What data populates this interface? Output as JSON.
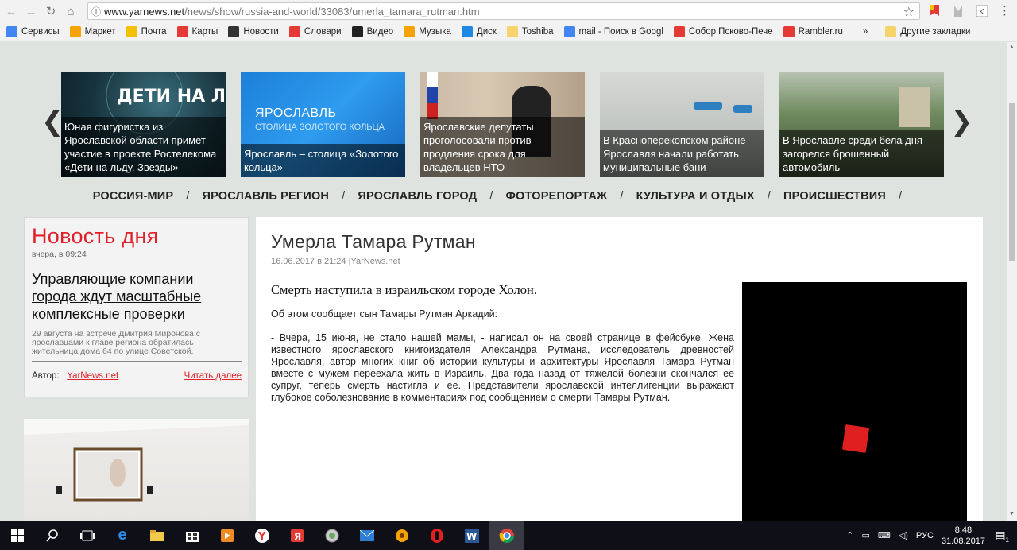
{
  "browser": {
    "url_host": "www.yarnews.net",
    "url_path": "/news/show/russia-and-world/33083/umerla_tamara_rutman.htm",
    "bookmarks": [
      {
        "label": "Сервисы",
        "icon": "apps-icon",
        "color": "#4285f4"
      },
      {
        "label": "Маркет",
        "icon": "market-icon",
        "color": "#f4a300"
      },
      {
        "label": "Почта",
        "icon": "mail-icon",
        "color": "#f4c000"
      },
      {
        "label": "Карты",
        "icon": "map-pin-icon",
        "color": "#e53935"
      },
      {
        "label": "Новости",
        "icon": "news-icon",
        "color": "#333333"
      },
      {
        "label": "Словари",
        "icon": "dictionary-icon",
        "color": "#e53935"
      },
      {
        "label": "Видео",
        "icon": "video-icon",
        "color": "#222222"
      },
      {
        "label": "Музыка",
        "icon": "music-icon",
        "color": "#f4a300"
      },
      {
        "label": "Диск",
        "icon": "disk-icon",
        "color": "#1e88e5"
      },
      {
        "label": "Toshiba",
        "icon": "folder-icon",
        "color": "#f6d36b"
      },
      {
        "label": "mail - Поиск в Googl",
        "icon": "google-icon",
        "color": "#4285f4"
      },
      {
        "label": "Собор Псково-Пече",
        "icon": "yandex-icon",
        "color": "#e53935"
      },
      {
        "label": "Rambler.ru",
        "icon": "rambler-icon",
        "color": "#e53935"
      }
    ],
    "more_label": "»",
    "other_bookmarks": "Другие закладки"
  },
  "carousel": {
    "prev": "❮",
    "next": "❯",
    "slides": [
      {
        "caption": "Юная фигуристка из Ярославской области примет участие в проекте Ростелекома «Дети на льду. Звезды»",
        "badge": "ДЕТИ НА ЛЬДУ"
      },
      {
        "caption": "Ярославль – столица «Золотого кольца»",
        "badge": "ЯРОСЛАВЛЬ",
        "badge2": "СТОЛИЦА ЗОЛОТОГО КОЛЬЦА"
      },
      {
        "caption": "Ярославские депутаты проголосовали против продления срока для владельцев НТО"
      },
      {
        "caption": "В Красноперекопском районе Ярославля начали работать муниципальные бани"
      },
      {
        "caption": "В Ярославле среди бела дня загорелся брошенный автомобиль"
      }
    ]
  },
  "sections": [
    "РОССИЯ-МИР",
    "ЯРОСЛАВЛЬ РЕГИОН",
    "ЯРОСЛАВЛЬ ГОРОД",
    "ФОТОРЕПОРТАЖ",
    "КУЛЬТУРА И ОТДЫХ",
    "ПРОИСШЕСТВИЯ"
  ],
  "section_sep": "/",
  "news_day": {
    "title": "Новость дня",
    "date": "вчера, в 09:24",
    "headline": "Управляющие компании города ждут масштабные комплексные проверки",
    "lead": "29 августа на встрече Дмитрия Миронова с ярославцами к главе региона обратилась жительница дома 64 по улице Советской.",
    "author_label": "Автор:",
    "author": "YarNews.net",
    "read_more": "Читать далее"
  },
  "article": {
    "title": "Умерла Тамара Рутман",
    "date": "16.06.2017 в 21:24",
    "source_sep": "|",
    "source": "YarNews.net",
    "lede": "Смерть наступила в израильском городе Холон.",
    "p1": "Об этом сообщает сын Тамары Рутман Аркадий:",
    "p2": "- Вчера, 15 июня, не стало нашей мамы, - написал он на своей странице в фейсбуке. Жена известного ярославского книгоиздателя Александра Рутмана, исследователь древностей Ярославля, автор многих книг об истории культуры и архитектуры Ярославля Тамара Рутман вместе с мужем переехала жить в Израиль. Два года назад от тяжелой болезни скончался ее супруг, теперь смерть настигла и ее. Представители ярославской интеллигенции выражают глубокое соболезнование в комментариях под сообщением о смерти Тамары Рутман."
  },
  "taskbar": {
    "lang": "РУС",
    "time": "8:48",
    "date": "31.08.2017",
    "notif_count": "1"
  }
}
